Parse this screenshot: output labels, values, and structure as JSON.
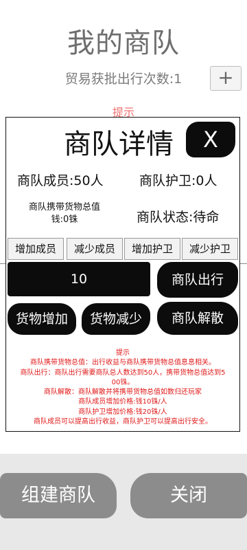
{
  "page": {
    "title": "我的商队",
    "trade_count_label": "贸易获批出行次数:1",
    "plus_label": "+",
    "hint_label": "提示"
  },
  "dialog": {
    "title": "商队详情",
    "close_label": "X",
    "members": "商队成员:50人",
    "guards": "商队护卫:0人",
    "cargo_label": "商队携带货物总值",
    "cargo_value": "钱:0铢",
    "status": "商队状态:待命",
    "buttons": {
      "add_member": "增加成员",
      "reduce_member": "减少成员",
      "add_guard": "增加护卫",
      "reduce_guard": "减少护卫",
      "depart": "商队出行",
      "cargo_add": "货物增加",
      "cargo_reduce": "货物减少",
      "disband": "商队解散"
    },
    "quantity": "10",
    "rules": [
      "提示",
      "商队携带货物总值：出行收益与商队携带货物总值息息相关。",
      "商队出行：商队出行需要商队总人数达到50人，携带货物总值达到5",
      "00铢。",
      "商队解散：商队解散并将携带货物总值如数归还玩家",
      "商队成员增加价格:钱10铢/人",
      "商队护卫增加价格:钱20铢/人",
      "商队成员可以提高出行收益，商队护卫可以提高出行安全。"
    ]
  },
  "footer": {
    "create_label": "组建商队",
    "close_label": "关闭"
  },
  "colors": {
    "hint_red": "#f07070",
    "rules_red": "#e01818",
    "brush_black": "#0c0c0c",
    "gray_button": "#8c8c8c"
  }
}
